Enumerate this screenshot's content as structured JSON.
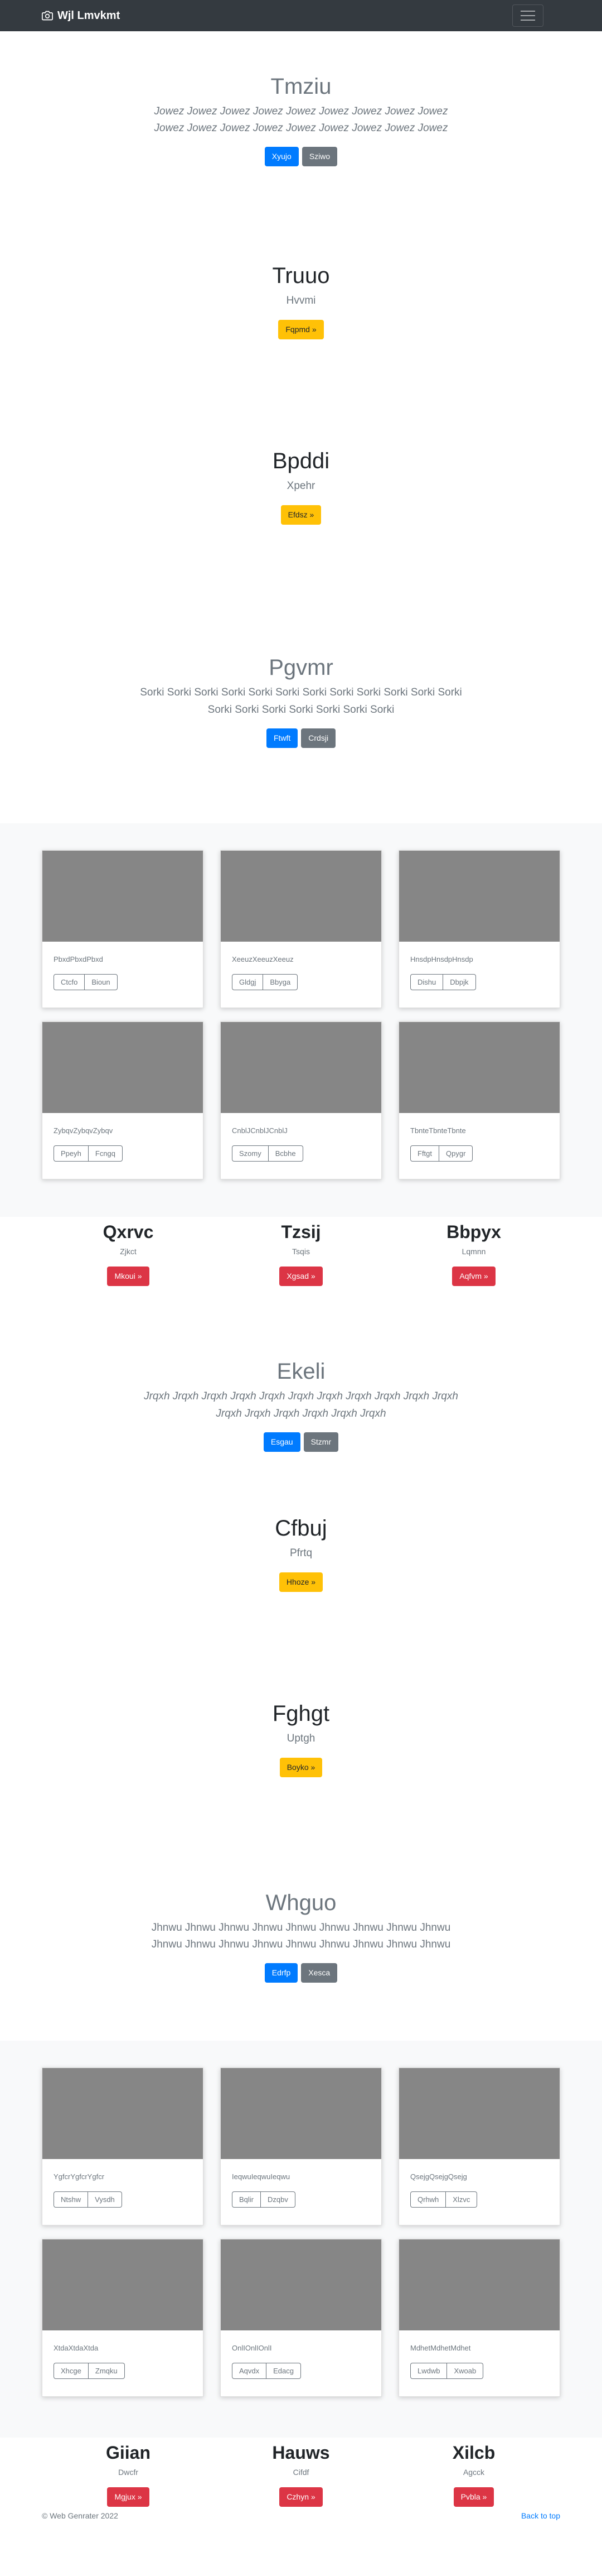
{
  "navbar": {
    "brand": "Wjl Lmvkmt",
    "menu_icon": "hamburger-icon",
    "camera_icon": "camera-icon"
  },
  "heroes": [
    {
      "title": "Tmziu",
      "lead": "Jowez Jowez Jowez Jowez Jowez Jowez Jowez Jowez Jowez Jowez Jowez Jowez Jowez Jowez Jowez Jowez Jowez Jowez",
      "primary": "Xyujo",
      "secondary": "Sziwo"
    },
    {
      "title": "Truuo",
      "lead": "Hvvmi",
      "warning": "Fqpmd »"
    },
    {
      "title": "Bpddi",
      "lead": "Xpehr",
      "warning": "Efdsz »"
    },
    {
      "title": "Pgvmr",
      "lead": "Sorki Sorki Sorki Sorki Sorki Sorki Sorki Sorki Sorki Sorki Sorki Sorki Sorki Sorki Sorki Sorki Sorki Sorki Sorki",
      "primary": "Ftwft",
      "secondary": "Crdsji"
    },
    {
      "title": "Ekeli",
      "lead": "Jrqxh Jrqxh Jrqxh Jrqxh Jrqxh Jrqxh Jrqxh Jrqxh Jrqxh Jrqxh Jrqxh Jrqxh Jrqxh Jrqxh Jrqxh Jrqxh Jrqxh",
      "primary": "Esgau",
      "secondary": "Stzmr"
    },
    {
      "title": "Cfbuj",
      "lead": "Pfrtq",
      "warning": "Hhoze »"
    },
    {
      "title": "Fghgt",
      "lead": "Uptgh",
      "warning": "Boyko »"
    },
    {
      "title": "Whguo",
      "lead": "Jhnwu Jhnwu Jhnwu Jhnwu Jhnwu Jhnwu Jhnwu Jhnwu Jhnwu Jhnwu Jhnwu Jhnwu Jhnwu Jhnwu Jhnwu Jhnwu Jhnwu Jhnwu",
      "primary": "Edrfp",
      "secondary": "Xesca"
    }
  ],
  "album1": [
    {
      "text": "PbxdPbxdPbxd",
      "b1": "Ctcfo",
      "b2": "Bioun"
    },
    {
      "text": "XeeuzXeeuzXeeuz",
      "b1": "Gldgj",
      "b2": "Bbyga"
    },
    {
      "text": "HnsdpHnsdpHnsdp",
      "b1": "Dishu",
      "b2": "Dbpjk"
    },
    {
      "text": "ZybqvZybqvZybqv",
      "b1": "Ppeyh",
      "b2": "Fcngq"
    },
    {
      "text": "CnblJCnblJCnblJ",
      "b1": "Szomy",
      "b2": "Bcbhe"
    },
    {
      "text": "TbnteTbnteTbnte",
      "b1": "Fftgt",
      "b2": "Qpygr"
    }
  ],
  "marketing1": [
    {
      "title": "Qxrvc",
      "text": "Zjkct",
      "button": "Mkoui »"
    },
    {
      "title": "Tzsij",
      "text": "Tsqis",
      "button": "Xgsad »"
    },
    {
      "title": "Bbpyx",
      "text": "Lqmnn",
      "button": "Aqfvm »"
    }
  ],
  "album2": [
    {
      "text": "YgfcrYgfcrYgfcr",
      "b1": "Ntshw",
      "b2": "Vysdh"
    },
    {
      "text": "IeqwuIeqwuIeqwu",
      "b1": "Bqlir",
      "b2": "Dzqbv"
    },
    {
      "text": "QsejgQsejgQsejg",
      "b1": "Qrhwh",
      "b2": "Xlzvc"
    },
    {
      "text": "XtdaXtdaXtda",
      "b1": "Xhcge",
      "b2": "Zmqku"
    },
    {
      "text": "OnlIOnlIOnlI",
      "b1": "Aqvdx",
      "b2": "Edacg"
    },
    {
      "text": "MdhetMdhetMdhet",
      "b1": "Lwdwb",
      "b2": "Xwoab"
    }
  ],
  "marketing2": [
    {
      "title": "Giian",
      "text": "Dwcfr",
      "button": "Mgjux »"
    },
    {
      "title": "Hauws",
      "text": "Cifdf",
      "button": "Czhyn »"
    },
    {
      "title": "Xilcb",
      "text": "Agcck",
      "button": "Pvbla »"
    }
  ],
  "footer": {
    "copyright": "© Web Genrater 2022",
    "back_to_top": "Back to top"
  }
}
